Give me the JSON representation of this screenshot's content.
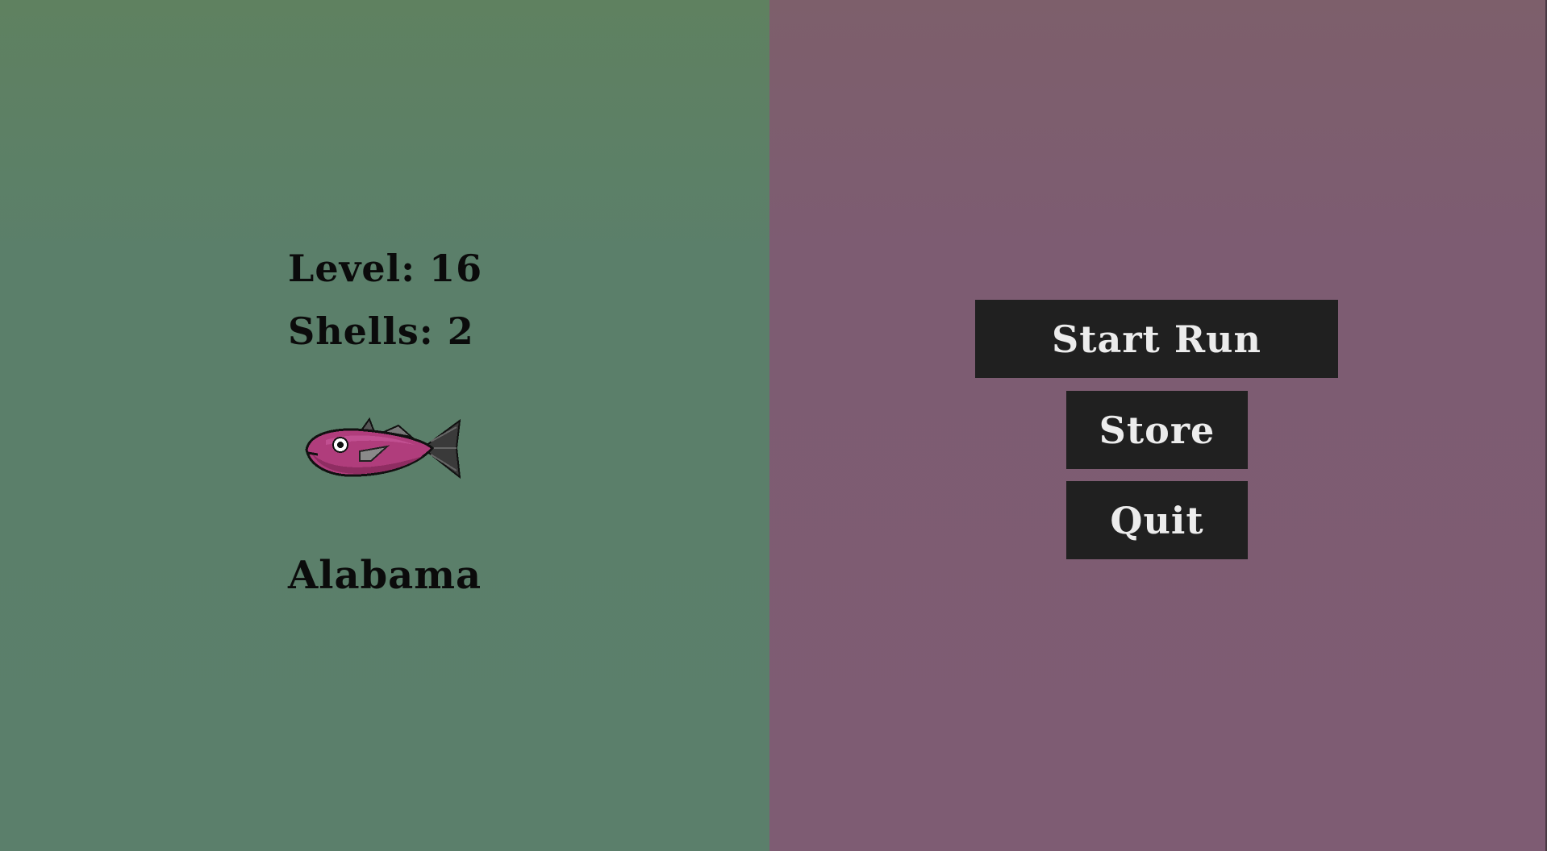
{
  "stats": {
    "level_text": "Level: 16",
    "shells_text": "Shells: 2"
  },
  "fish": {
    "name": "Alabama",
    "icon": "pink-fish-sprite"
  },
  "menu": {
    "start_label": "Start Run",
    "store_label": "Store",
    "quit_label": "Quit"
  },
  "colors": {
    "left_panel": "#5b7f6a",
    "right_panel": "#7e5c73",
    "button_bg": "#202020",
    "button_text": "#ececec",
    "fish_body": "#b03d7c"
  }
}
